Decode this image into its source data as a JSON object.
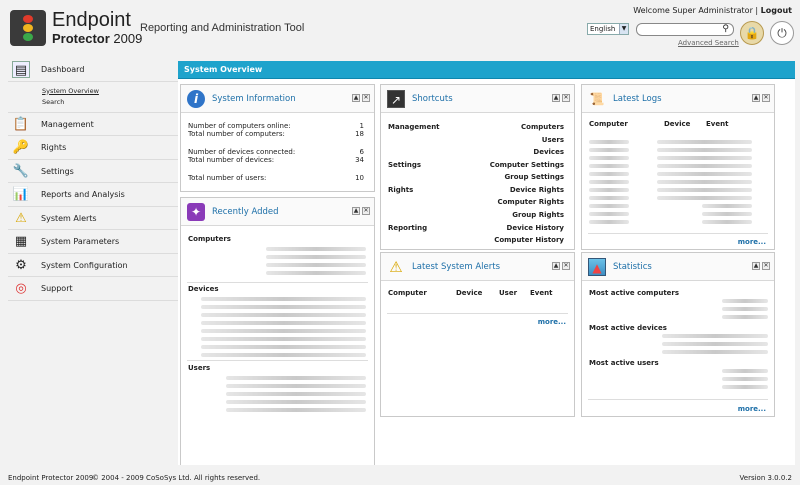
{
  "header": {
    "logo_line1": "Endpoint",
    "logo_line2_bold": "Protector",
    "logo_line2_year": "2009",
    "subtitle": "Reporting and Administration Tool",
    "welcome_text": "Welcome Super Administrator",
    "separator": "|",
    "logout_label": "Logout",
    "language_value": "English",
    "search_placeholder": "",
    "advanced_search_label": "Advanced Search"
  },
  "sidebar": {
    "items": [
      {
        "label": "Dashboard",
        "icon": "dashboard-icon"
      },
      {
        "label": "Management",
        "icon": "management-icon"
      },
      {
        "label": "Rights",
        "icon": "rights-icon"
      },
      {
        "label": "Settings",
        "icon": "settings-icon"
      },
      {
        "label": "Reports and Analysis",
        "icon": "reports-icon"
      },
      {
        "label": "System Alerts",
        "icon": "alert-icon"
      },
      {
        "label": "System Parameters",
        "icon": "parameters-icon"
      },
      {
        "label": "System Configuration",
        "icon": "configuration-icon"
      },
      {
        "label": "Support",
        "icon": "support-icon"
      }
    ],
    "subitems": [
      "System Overview",
      "Search"
    ]
  },
  "main": {
    "title": "System Overview",
    "system_information": {
      "title": "System Information",
      "rows": [
        {
          "label": "Number of computers online:",
          "value": "1"
        },
        {
          "label": "Total number of computers:",
          "value": "18"
        },
        {
          "label": "Number of devices connected:",
          "value": "6"
        },
        {
          "label": "Total number of devices:",
          "value": "34"
        },
        {
          "label": "Total number of users:",
          "value": "10"
        }
      ]
    },
    "recently_added": {
      "title": "Recently Added",
      "sections": [
        "Computers",
        "Devices",
        "Users"
      ]
    },
    "shortcuts": {
      "title": "Shortcuts",
      "rows": [
        {
          "section": "Management",
          "link": "Computers"
        },
        {
          "section": "",
          "link": "Users"
        },
        {
          "section": "",
          "link": "Devices"
        },
        {
          "section": "Settings",
          "link": "Computer Settings"
        },
        {
          "section": "",
          "link": "Group Settings"
        },
        {
          "section": "Rights",
          "link": "Device Rights"
        },
        {
          "section": "",
          "link": "Computer Rights"
        },
        {
          "section": "",
          "link": "Group Rights"
        },
        {
          "section": "Reporting",
          "link": "Device History"
        },
        {
          "section": "",
          "link": "Computer History"
        }
      ]
    },
    "latest_logs": {
      "title": "Latest Logs",
      "columns": [
        "Computer",
        "Device",
        "Event"
      ],
      "more": "more..."
    },
    "latest_alerts": {
      "title": "Latest System Alerts",
      "columns": [
        "Computer",
        "Device",
        "User",
        "Event"
      ],
      "more": "more..."
    },
    "statistics": {
      "title": "Statistics",
      "sections": [
        "Most active computers",
        "Most active devices",
        "Most active users"
      ],
      "more": "more..."
    }
  },
  "footer": {
    "app_name": "Endpoint Protector 2009",
    "copyright": "© 2004 - 2009 CoSoSys Ltd. All rights reserved.",
    "version": "Version 3.0.0.2"
  }
}
